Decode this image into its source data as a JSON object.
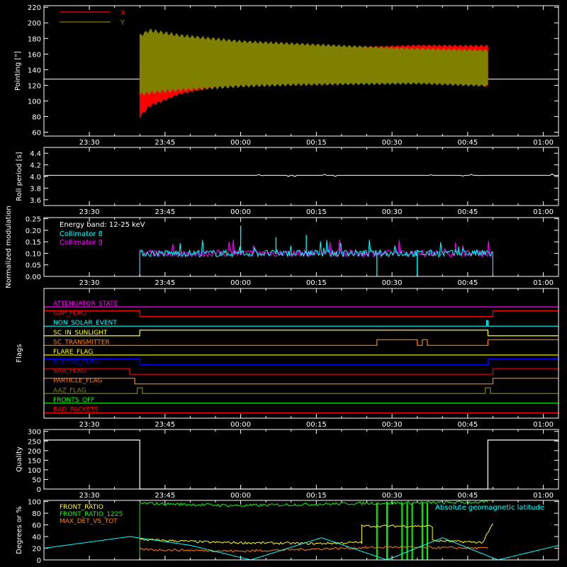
{
  "chart_data": [
    {
      "type": "line",
      "ylabel": "Pointing [\"]",
      "yticks": [
        60,
        80,
        100,
        120,
        140,
        160,
        180,
        200,
        220
      ],
      "ylim": [
        55,
        222
      ],
      "xticks": [
        "23:30",
        "23:45",
        "00:00",
        "00:15",
        "00:30",
        "00:45",
        "01:00"
      ],
      "series": [
        {
          "name": "X",
          "color": "#ff0000",
          "envelope": {
            "t": [
              "23:40",
              "23:42",
              "23:48",
              "00:00",
              "00:10",
              "00:20",
              "00:35",
              "00:49"
            ],
            "low": [
              78,
              92,
              108,
              124,
              131,
              135,
              137,
              117
            ],
            "high": [
              150,
              152,
              154,
              160,
              165,
              169,
              172,
              172
            ]
          }
        },
        {
          "name": "Y",
          "color": "#808000",
          "envelope": {
            "t": [
              "23:40",
              "23:42",
              "23:48",
              "00:00",
              "00:10",
              "00:20",
              "00:35",
              "00:49"
            ],
            "low": [
              106,
              108,
              112,
              117,
              119,
              120,
              121,
              118
            ],
            "high": [
              186,
              193,
              186,
              178,
              175,
              172,
              168,
              166
            ]
          }
        }
      ],
      "baseline": 128
    },
    {
      "type": "line",
      "ylabel": "Roll period [s]",
      "yticks": [
        "3.6",
        "3.8",
        "4.0",
        "4.2",
        "4.4"
      ],
      "ylim": [
        3.5,
        4.5
      ],
      "xticks": [
        "23:30",
        "23:45",
        "00:00",
        "00:15",
        "00:30",
        "00:45",
        "01:00"
      ],
      "series": [
        {
          "name": "",
          "color": "#ffffff",
          "value": 4.02
        }
      ]
    },
    {
      "type": "line",
      "ylabel": "Normalized modulation",
      "yticks": [
        "0.00",
        "0.05",
        "0.10",
        "0.15",
        "0.20",
        "0.25"
      ],
      "ylim": [
        0,
        0.255
      ],
      "xticks": [
        "23:30",
        "23:45",
        "00:00",
        "00:15",
        "00:30",
        "00:45",
        "01:00"
      ],
      "annotation": "Energy band: 12-25 keV",
      "active_range": [
        "23:40",
        "00:50"
      ],
      "series": [
        {
          "name": "Collimator 8",
          "color": "#00ffff",
          "mean": 0.1,
          "spikes": [
            {
              "t": "00:00",
              "v": 0.22
            },
            {
              "t": "00:07",
              "v": 0.17
            },
            {
              "t": "00:13",
              "v": 0.18
            },
            {
              "t": "00:27",
              "v": 0.0
            },
            {
              "t": "00:35",
              "v": 0.0
            }
          ]
        },
        {
          "name": "Collimator 9",
          "color": "#ff00ff",
          "mean": 0.1
        }
      ]
    },
    {
      "type": "line",
      "ylabel": "Flags",
      "xticks": [
        "23:30",
        "23:45",
        "00:00",
        "00:15",
        "00:30",
        "00:45",
        "01:00"
      ],
      "flags": [
        {
          "name": "ATTENUATOR_STATE",
          "color": "#ff00ff",
          "edges": []
        },
        {
          "name": "GAP_FLAG",
          "color": "#ff0000",
          "start_high": true,
          "edges": [
            "23:40",
            "00:50"
          ]
        },
        {
          "name": "NON_SOLAR_EVENT",
          "color": "#00ffff",
          "start_high": false,
          "edges": [
            "00:48:45",
            "00:49"
          ]
        },
        {
          "name": "SC_IN_SUNLIGHT",
          "color": "#ffff00",
          "start_high": false,
          "edges": [
            "23:40",
            "00:49"
          ]
        },
        {
          "name": "SC_TRANSMITTER",
          "color": "#ff8000",
          "start_high": false,
          "edges": [
            "00:27",
            "00:35",
            "00:36",
            "00:37",
            "00:49"
          ]
        },
        {
          "name": "FLARE_FLAG",
          "color": "#ffff00",
          "edges": []
        },
        {
          "name": "ECLIPSE_FLAG",
          "color": "#0000ff",
          "start_high": true,
          "edges": [
            "23:40",
            "00:49"
          ]
        },
        {
          "name": "SAA_FLAG",
          "color": "#ff0000",
          "start_high": true,
          "edges": [
            "23:38",
            "00:50"
          ]
        },
        {
          "name": "PARTICLE_FLAG",
          "color": "#ff8000",
          "start_high": true,
          "edges": [
            "23:39",
            "00:50"
          ]
        },
        {
          "name": "AAZ_FLAG",
          "color": "#808000",
          "start_high": false,
          "edges": [
            "23:39.5",
            "23:40.5",
            "00:48.5",
            "00:49.5"
          ]
        },
        {
          "name": "FRONTS_OFF",
          "color": "#00ff00",
          "edges": []
        },
        {
          "name": "BAD_PACKETS",
          "color": "#ff0000",
          "edges": []
        }
      ]
    },
    {
      "type": "line",
      "ylabel": "Quality",
      "yticks": [
        0,
        50,
        100,
        150,
        200,
        250,
        300
      ],
      "ylim": [
        0,
        310
      ],
      "xticks": [
        "23:30",
        "23:45",
        "00:00",
        "00:15",
        "00:30",
        "00:45",
        "01:00"
      ],
      "series": [
        {
          "name": "",
          "color": "#ffffff",
          "steps": [
            {
              "t": "23:21",
              "v": 255
            },
            {
              "t": "23:40",
              "v": 0
            },
            {
              "t": "00:49",
              "v": 255
            },
            {
              "t": "01:03",
              "v": 255
            }
          ]
        }
      ]
    },
    {
      "type": "line",
      "ylabel": "Degrees or %",
      "yticks": [
        0,
        20,
        40,
        60,
        80,
        100
      ],
      "ylim": [
        0,
        102
      ],
      "annotation": "Absolute geomagnetic latitude",
      "series": [
        {
          "name": "FRONT_RATIO",
          "color": "#ffff00",
          "points": [
            [
              "23:40",
              35
            ],
            [
              "23:55",
              30
            ],
            [
              "00:15",
              28
            ],
            [
              "00:24",
              30
            ],
            [
              "00:24",
              58
            ],
            [
              "00:38",
              58
            ],
            [
              "00:38",
              33
            ],
            [
              "00:48",
              30
            ],
            [
              "00:50",
              62
            ]
          ]
        },
        {
          "name": "FRONT_RATIO_1225",
          "color": "#00ff00",
          "points": [
            [
              "23:40",
              97
            ],
            [
              "00:00",
              93
            ],
            [
              "00:24",
              97
            ],
            [
              "00:49",
              99
            ]
          ]
        },
        {
          "name": "MAX_DET_VS_TOT",
          "color": "#ff8000",
          "points": [
            [
              "23:40",
              18
            ],
            [
              "00:00",
              15
            ],
            [
              "00:20",
              20
            ],
            [
              "00:30",
              22
            ],
            [
              "00:49",
              20
            ]
          ]
        },
        {
          "name": "Absolute geomagnetic latitude",
          "color": "#00ffff",
          "points": [
            [
              "23:21",
              20
            ],
            [
              "23:38",
              40
            ],
            [
              "23:50",
              25
            ],
            [
              "00:02",
              0
            ],
            [
              "00:16",
              38
            ],
            [
              "00:29",
              0
            ],
            [
              "00:40",
              38
            ],
            [
              "00:51",
              0
            ],
            [
              "01:03",
              25
            ]
          ]
        }
      ],
      "green_spikes": [
        "00:27",
        "00:29",
        "00:32",
        "00:33",
        "00:34",
        "00:36",
        "00:37"
      ]
    }
  ]
}
